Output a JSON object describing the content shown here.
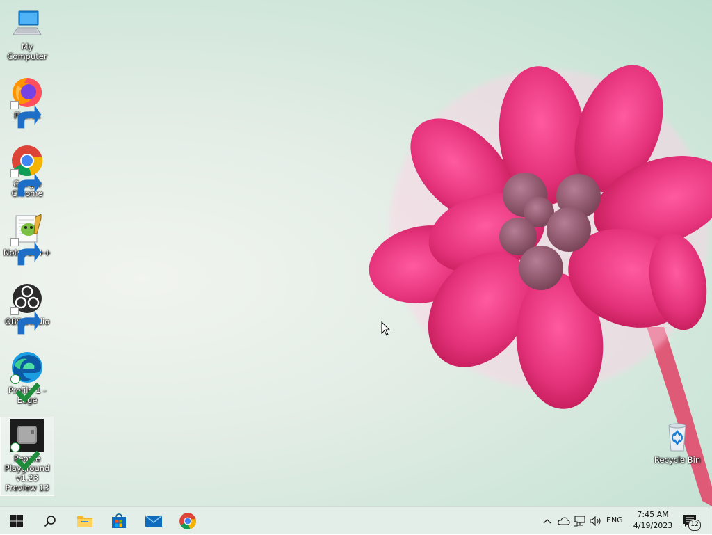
{
  "desktop": {
    "icons": [
      {
        "label": "My Computer"
      },
      {
        "label": "Firefox"
      },
      {
        "label": "Google Chrome"
      },
      {
        "label": "Notepad++"
      },
      {
        "label": "OBS Studio"
      },
      {
        "label": "Profile 1 - Edge"
      },
      {
        "label": "People Playground v1.23 Preview 13"
      },
      {
        "label": "Recycle Bin"
      }
    ]
  },
  "taskbar": {
    "pinned": [
      "start-icon",
      "search-icon",
      "file-explorer-icon",
      "microsoft-store-icon",
      "mail-icon",
      "chrome-icon"
    ],
    "tray": {
      "language": "ENG",
      "time": "7:45 AM",
      "date": "4/19/2023",
      "notification_count": "12"
    }
  },
  "colors": {
    "flower": "#e4327a",
    "taskbar_bg": "#e4eee9",
    "accent_blue": "#0078d4"
  }
}
